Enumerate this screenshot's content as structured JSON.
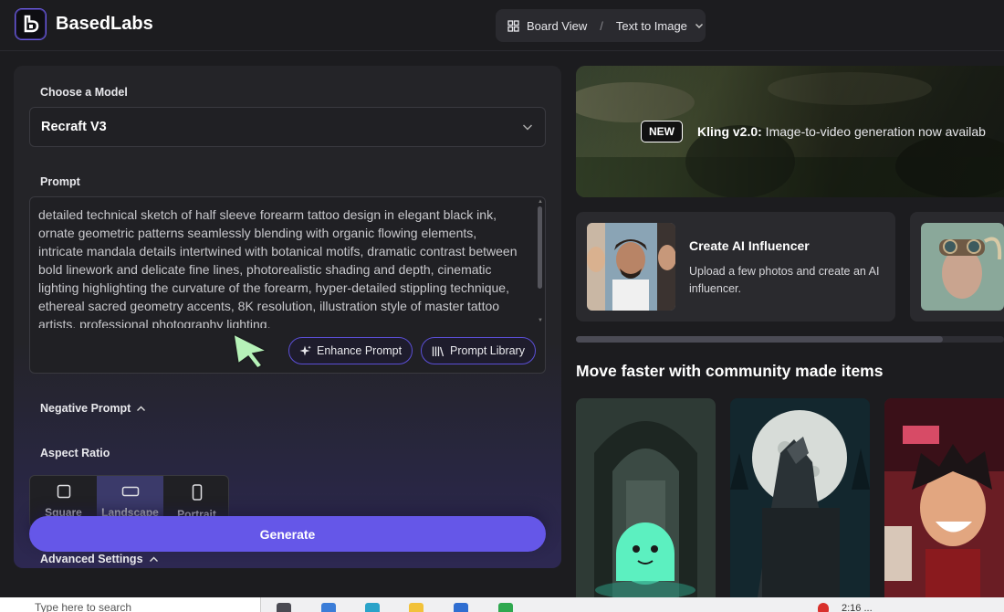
{
  "header": {
    "brand": "BasedLabs",
    "breadcrumb": {
      "first": "Board View",
      "separator": "/",
      "current": "Text to Image"
    }
  },
  "form": {
    "model_label": "Choose a Model",
    "model_value": "Recraft V3",
    "prompt_label": "Prompt",
    "prompt_text": "detailed technical sketch of half sleeve forearm tattoo design in elegant black ink, ornate geometric patterns seamlessly blending with organic flowing elements, intricate mandala details intertwined with botanical motifs, dramatic contrast between bold linework and delicate fine lines, photorealistic shading and depth, cinematic lighting highlighting the curvature of the forearm, hyper-detailed stippling technique, ethereal sacred geometry accents, 8K resolution, illustration style of master tattoo artists, professional photography lighting,",
    "enhance_label": "Enhance Prompt",
    "library_label": "Prompt Library",
    "negative_label": "Negative Prompt",
    "aspect_label": "Aspect Ratio",
    "aspect_options": [
      {
        "label": "Square"
      },
      {
        "label": "Landscape",
        "selected": true
      },
      {
        "label": "Portrait"
      }
    ],
    "generate_label": "Generate",
    "advanced_label": "Advanced Settings"
  },
  "banner": {
    "badge": "NEW",
    "headline": "Kling v2.0:",
    "text": " Image-to-video generation now availab"
  },
  "cards": [
    {
      "title": "Create AI Influencer",
      "desc": "Upload a few photos and create an AI influencer."
    }
  ],
  "community": {
    "title": "Move faster with community made items"
  },
  "taskbar": {
    "search_placeholder": "Type here to search",
    "time_fragment": "2:16 ..."
  },
  "colors": {
    "accent": "#6557e8",
    "accent_border": "#5b4fd6",
    "panel_bg": "#242428",
    "page_bg": "#1c1c1f"
  }
}
